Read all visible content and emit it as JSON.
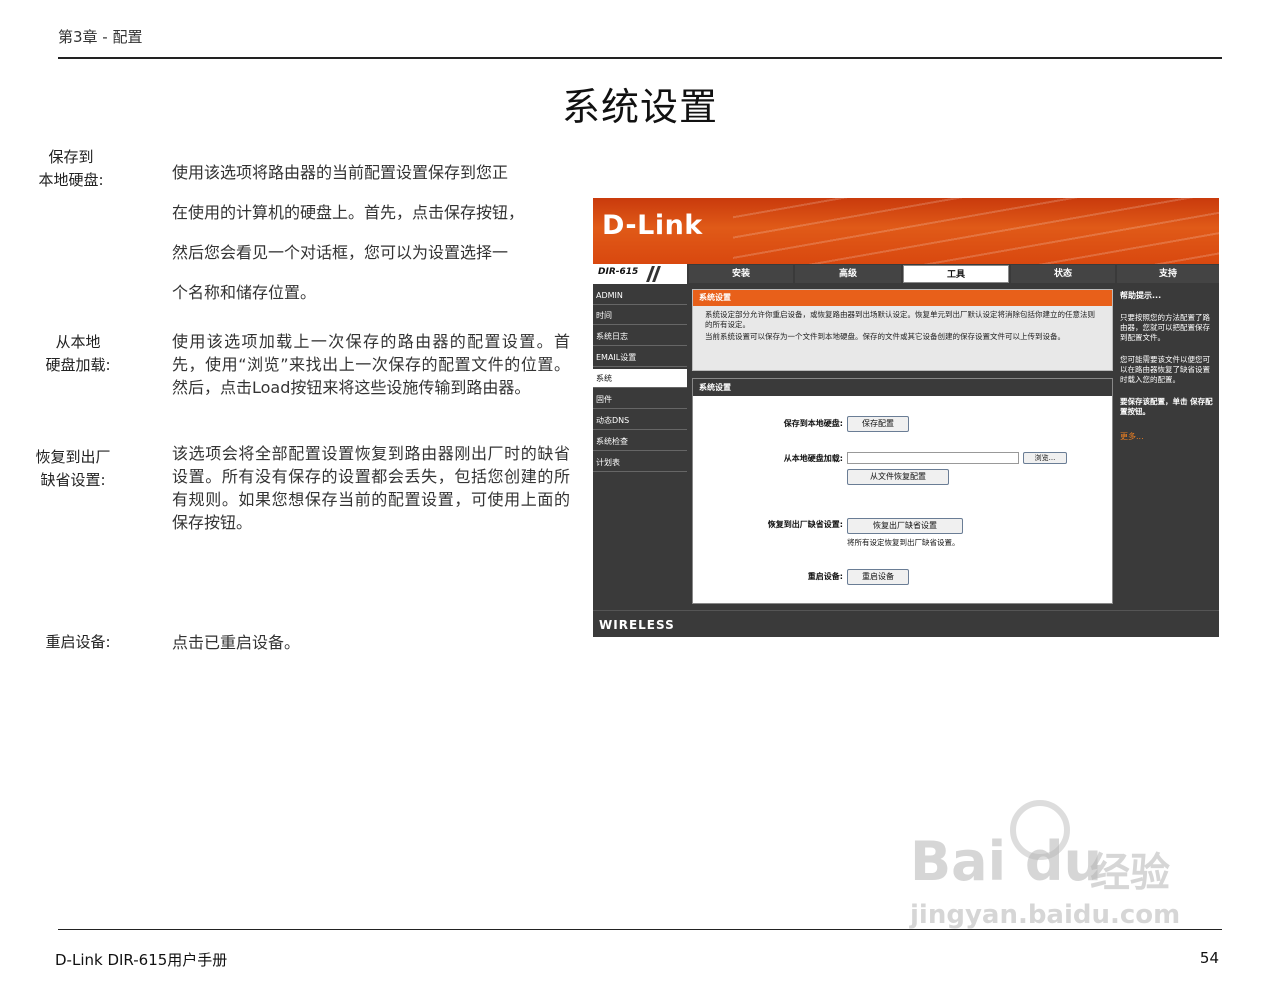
{
  "header": {
    "chapter": "第3章 - 配置",
    "title": "系统设置"
  },
  "sections": [
    {
      "label1": "保存到",
      "label2": "本地硬盘:",
      "lines": [
        "使用该选项将路由器的当前配置设置保存到您正",
        "在使用的计算机的硬盘上。首先，点击保存按钮，",
        "然后您会看见一个对话框，您可以为设置选择一",
        "个名称和储存位置。"
      ]
    },
    {
      "label1": "从本地",
      "label2": "硬盘加载:",
      "text": "使用该选项加载上一次保存的路由器的配置设置。首先，使用“浏览”来找出上一次保存的配置文件的位置。然后，点击Load按钮来将这些设施传输到路由器。"
    },
    {
      "label1": "恢复到出厂",
      "label2": "缺省设置:",
      "text": "该选项会将全部配置设置恢复到路由器刚出厂时的缺省设置。所有没有保存的设置都会丢失，包括您创建的所有规则。如果您想保存当前的配置设置，可使用上面的保存按钮。"
    },
    {
      "label1": "重启设备:",
      "text": "点击已重启设备。"
    }
  ],
  "router": {
    "logo": "D-Link",
    "model": "DIR-615",
    "tabs": [
      "安装",
      "高级",
      "工具",
      "状态",
      "支持"
    ],
    "active_tab": "工具",
    "sidebar": [
      "ADMIN",
      "时间",
      "系统日志",
      "EMAIL设置",
      "系统",
      "固件",
      "动态DNS",
      "系统检查",
      "计划表"
    ],
    "active_side": "系统",
    "info_title": "系统设置",
    "info_text1": "系统设定部分允许你重启设备，或恢复路由器到出场默认设定。恢复单元到出厂默认设定将消除包括你建立的任意法则的所有设定。",
    "info_text2": "当前系统设置可以保存为一个文件到本地硬盘。保存的文件或其它设备创建的保存设置文件可以上传到设备。",
    "form_title": "系统设置",
    "save_label": "保存到本地硬盘:",
    "save_btn": "保存配置",
    "load_label": "从本地硬盘加载:",
    "browse_btn": "浏览...",
    "restore_file_btn": "从文件恢复配置",
    "factory_label": "恢复到出厂缺省设置:",
    "factory_btn": "恢复出厂缺省设置",
    "factory_note": "将所有设定恢复到出厂缺省设置。",
    "reboot_label": "重启设备:",
    "reboot_btn": "重启设备",
    "help_title": "帮助提示...",
    "help1": "只要按照您的方法配置了路由器，您就可以把配置保存到配置文件。",
    "help2": "您可能需要该文件以便您可以在路由器恢复了缺省设置时载入您的配置。",
    "help3": "要保存该配置，单击 保存配置按钮。",
    "help_more": "更多...",
    "footer": "WIRELESS"
  },
  "footer": {
    "left": "D-Link DIR-615用户手册",
    "page": "54"
  },
  "watermark": {
    "brand": "Bai du",
    "cn": "经验",
    "url": "jingyan.baidu.com"
  }
}
